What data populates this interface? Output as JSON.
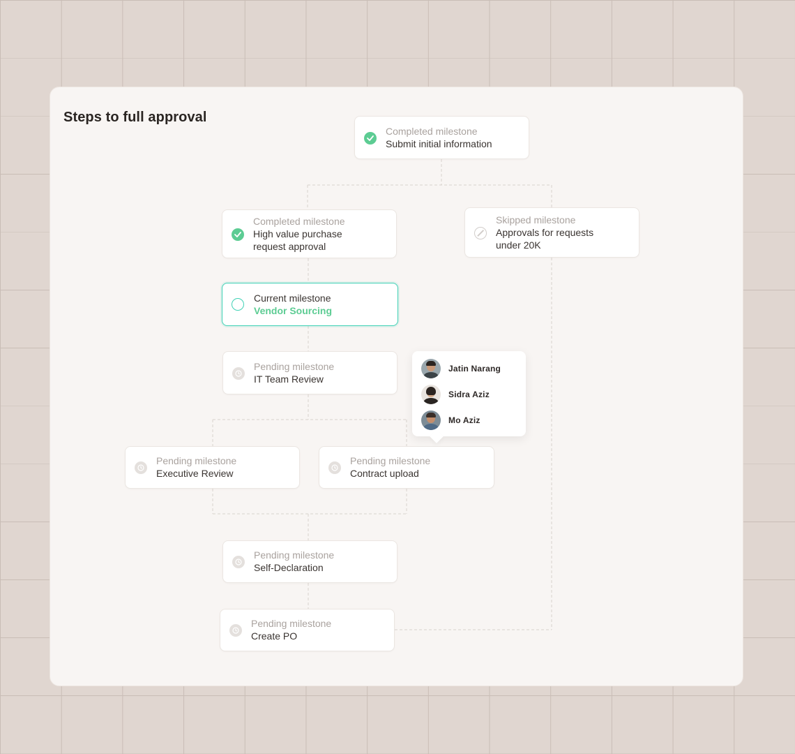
{
  "title": "Steps to full approval",
  "milestones": {
    "submit": {
      "sub": "Completed milestone",
      "main": "Submit initial information",
      "status": "completed"
    },
    "high_value": {
      "sub": "Completed milestone",
      "main_line1": "High value purchase",
      "main_line2": "request approval",
      "status": "completed"
    },
    "skipped": {
      "sub": "Skipped milestone",
      "main_line1": "Approvals for requests",
      "main_line2": "under 20K",
      "status": "skipped"
    },
    "vendor": {
      "sub": "Current milestone",
      "main": "Vendor Sourcing",
      "status": "current"
    },
    "it_review": {
      "sub": "Pending milestone",
      "main": "IT Team Review",
      "status": "pending"
    },
    "exec_review": {
      "sub": "Pending milestone",
      "main": "Executive Review",
      "status": "pending"
    },
    "contract": {
      "sub": "Pending milestone",
      "main": "Contract upload",
      "status": "pending"
    },
    "self_decl": {
      "sub": "Pending milestone",
      "main": "Self-Declaration",
      "status": "pending"
    },
    "create_po": {
      "sub": "Pending milestone",
      "main": "Create PO",
      "status": "pending"
    }
  },
  "assignees": [
    {
      "name": "Jatin Narang"
    },
    {
      "name": "Sidra Aziz"
    },
    {
      "name": "Mo Aziz"
    }
  ],
  "colors": {
    "completed": "#5ccc93",
    "current_border": "#3fd1b5",
    "pending_icon": "#e4e0dd",
    "connector": "#d9d2cd",
    "card_bg": "#f8f5f3",
    "page_bg": "#e0d6d0"
  },
  "icons": {
    "completed": "check-circle-icon",
    "skipped": "slash-circle-icon",
    "current": "empty-circle-icon",
    "pending": "clock-icon"
  }
}
